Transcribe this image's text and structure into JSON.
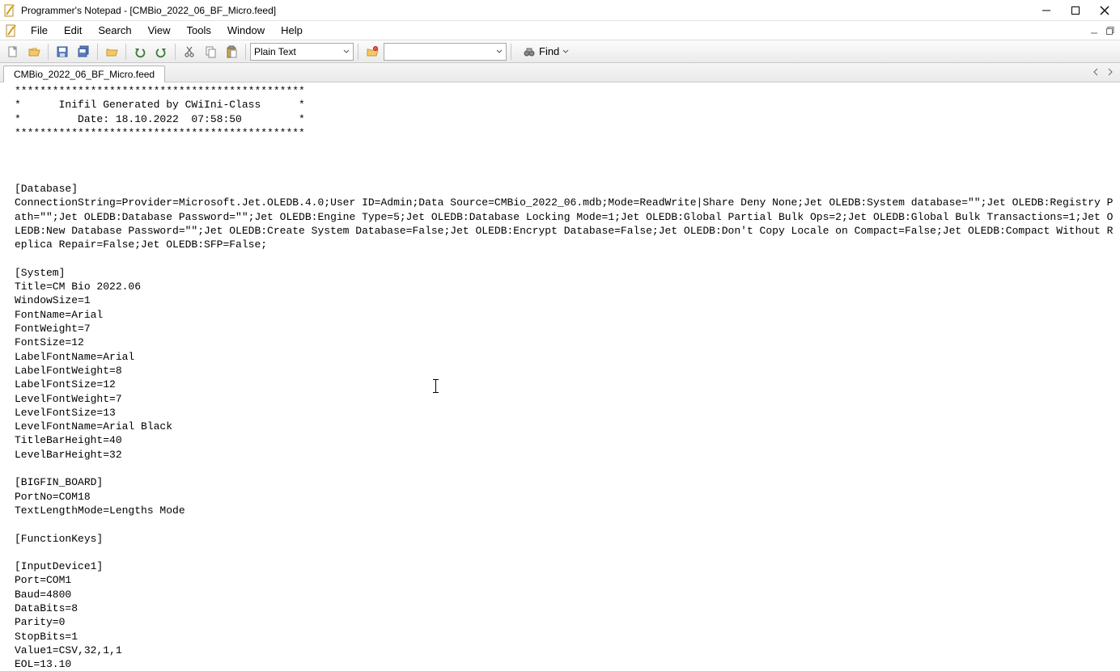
{
  "window": {
    "title": "Programmer's Notepad - [CMBio_2022_06_BF_Micro.feed]"
  },
  "menubar": {
    "items": [
      "File",
      "Edit",
      "Search",
      "View",
      "Tools",
      "Window",
      "Help"
    ]
  },
  "toolbar": {
    "scheme_combo": "Plain Text",
    "find_label": "Find"
  },
  "tabs": {
    "active": "CMBio_2022_06_BF_Micro.feed"
  },
  "editor": {
    "content": "**********************************************\n*      Inifil Generated by CWiIni-Class      *\n*         Date: 18.10.2022  07:58:50         *\n**********************************************\n\n\n\n[Database]\nConnectionString=Provider=Microsoft.Jet.OLEDB.4.0;User ID=Admin;Data Source=CMBio_2022_06.mdb;Mode=ReadWrite|Share Deny None;Jet OLEDB:System database=\"\";Jet OLEDB:Registry Path=\"\";Jet OLEDB:Database Password=\"\";Jet OLEDB:Engine Type=5;Jet OLEDB:Database Locking Mode=1;Jet OLEDB:Global Partial Bulk Ops=2;Jet OLEDB:Global Bulk Transactions=1;Jet OLEDB:New Database Password=\"\";Jet OLEDB:Create System Database=False;Jet OLEDB:Encrypt Database=False;Jet OLEDB:Don't Copy Locale on Compact=False;Jet OLEDB:Compact Without Replica Repair=False;Jet OLEDB:SFP=False;\n\n[System]\nTitle=CM Bio 2022.06\nWindowSize=1\nFontName=Arial\nFontWeight=7\nFontSize=12\nLabelFontName=Arial\nLabelFontWeight=8\nLabelFontSize=12\nLevelFontWeight=7\nLevelFontSize=13\nLevelFontName=Arial Black\nTitleBarHeight=40\nLevelBarHeight=32\n\n[BIGFIN_BOARD]\nPortNo=COM18\nTextLengthMode=Lengths Mode\n\n[FunctionKeys]\n\n[InputDevice1]\nPort=COM1\nBaud=4800\nDataBits=8\nParity=0\nStopBits=1\nValue1=CSV,32,1,1\nEOL=13.10"
  }
}
